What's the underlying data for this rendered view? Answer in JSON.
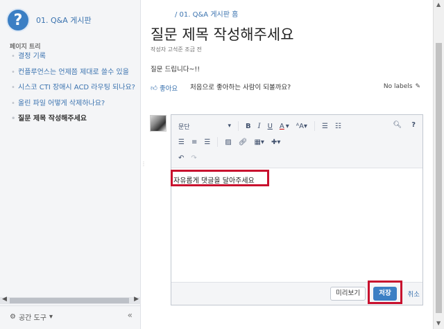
{
  "space": {
    "name": "01. Q&A 게시판",
    "logo_glyph": "?"
  },
  "sidebar": {
    "tree_title": "페이지 트리",
    "items": [
      "결정 기록",
      "컨플루언스는 언제쯤 제대로 쓸수 있을",
      "시스코 CTI 장애시 ACD 라우팅 되나요?",
      "올린 파일 어떻게 삭제하나요?",
      "질문 제목 작성해주세요"
    ],
    "space_tools": "공간 도구",
    "collapse": "«"
  },
  "page": {
    "breadcrumb": "/ 01. Q&A 게시판 홈",
    "title": "질문 제목 작성해주세요",
    "byline": "작성자 고석준 조금 전",
    "body": "질문 드립니다~!!",
    "like_label": "좋아요",
    "like_text": "처음으로 좋아하는 사람이 되볼까요?",
    "labels": "No labels"
  },
  "editor": {
    "format_select": "문단",
    "content": "자유롭게 댓글을 달아주세요",
    "preview_button": "미리보기",
    "save_button": "저장",
    "cancel_link": "취소"
  },
  "colors": {
    "accent": "#3b7fc4",
    "link": "#3b73af",
    "highlight": "#c8102e"
  }
}
